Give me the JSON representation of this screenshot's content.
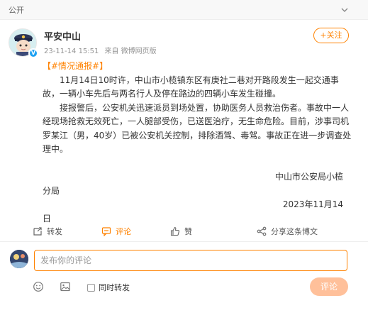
{
  "header": {
    "visibility": "公开"
  },
  "post": {
    "author": "平安中山",
    "timestamp": "23-11-14 15:51",
    "source_prefix": "来自",
    "source": "微博网页版",
    "follow_label": "+关注",
    "tag": "【#情况通报#】",
    "paragraph1": "11月14日10时许，中山市小榄镇东区有庚社二巷对开路段发生一起交通事故，一辆小车先后与两名行人及停在路边的四辆小车发生碰撞。",
    "paragraph2": "接报警后，公安机关迅速派员到场处置，协助医务人员救治伤者。事故中一人经现场抢救无效死亡，一人腿部受伤，已送医治疗，无生命危险。目前，涉事司机罗某江（男，40岁）已被公安机关控制，排除酒驾、毒驾。事故正在进一步调查处理中。",
    "signature_line1": "中山市公安局小榄",
    "signature_line2": "分局",
    "date_line1": "2023年11月14",
    "date_line2": "日"
  },
  "actions": {
    "repost": "转发",
    "comment": "评论",
    "like": "赞",
    "share": "分享这条博文"
  },
  "comment_box": {
    "placeholder": "发布你的评论",
    "repost_option": "同时转发",
    "submit_label": "评论"
  },
  "colors": {
    "accent": "#ff8200",
    "submit_bg": "#ffc09a"
  },
  "icons": [
    "chevron-down-icon",
    "verified-badge-icon",
    "repost-icon",
    "comment-icon",
    "like-icon",
    "share-icon",
    "emoji-icon",
    "image-icon"
  ]
}
